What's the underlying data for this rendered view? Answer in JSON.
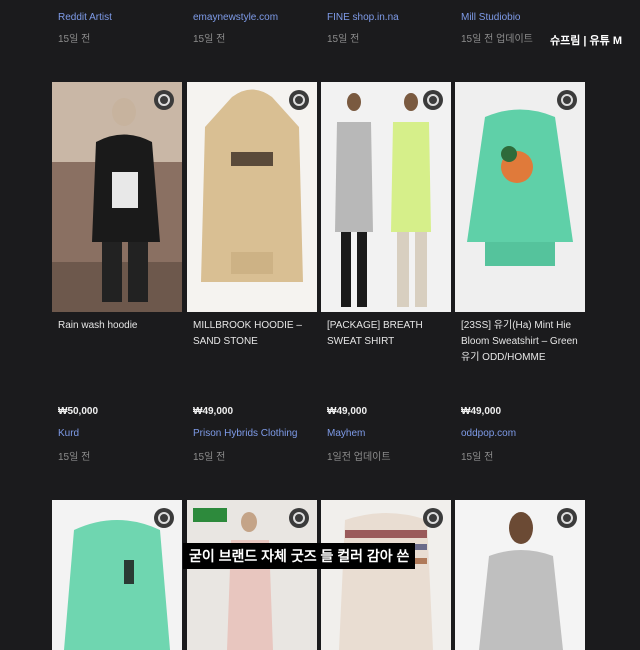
{
  "top_items": [
    {
      "seller": "Reddit Artist",
      "date": "15일 전"
    },
    {
      "seller": "emaynewstyle.com",
      "date": "15일 전"
    },
    {
      "seller": "FINE shop.in.na",
      "date": "15일 전"
    },
    {
      "seller": "Mill Studiobio",
      "date": "15일 전 업데이트"
    }
  ],
  "overlay_badge": "슈프림 | 유튜 M",
  "products_row1": [
    {
      "title": "Rain wash hoodie",
      "price": "₩50,000",
      "seller": "Kurd",
      "date": "15일 전"
    },
    {
      "title": "MILLBROOK HOODIE – SAND STONE",
      "price": "₩49,000",
      "seller": "Prison Hybrids Clothing",
      "date": "15일 전"
    },
    {
      "title": "[PACKAGE] BREATH SWEAT SHIRT",
      "price": "₩49,000",
      "seller": "Mayhem",
      "date": "1일전 업데이트"
    },
    {
      "title": "[23SS] 유기(Ha) Mint Hie Bloom Sweatshirt – Green 유기 ODD/HOMME",
      "price": "₩49,000",
      "seller": "oddpop.com",
      "date": "15일 전"
    }
  ],
  "caption": "굳이 브랜드 자체 굿즈 들 컬러 감아 쓴",
  "colors": {
    "accent_link": "#7e9be8",
    "background": "#1b1b1d"
  }
}
